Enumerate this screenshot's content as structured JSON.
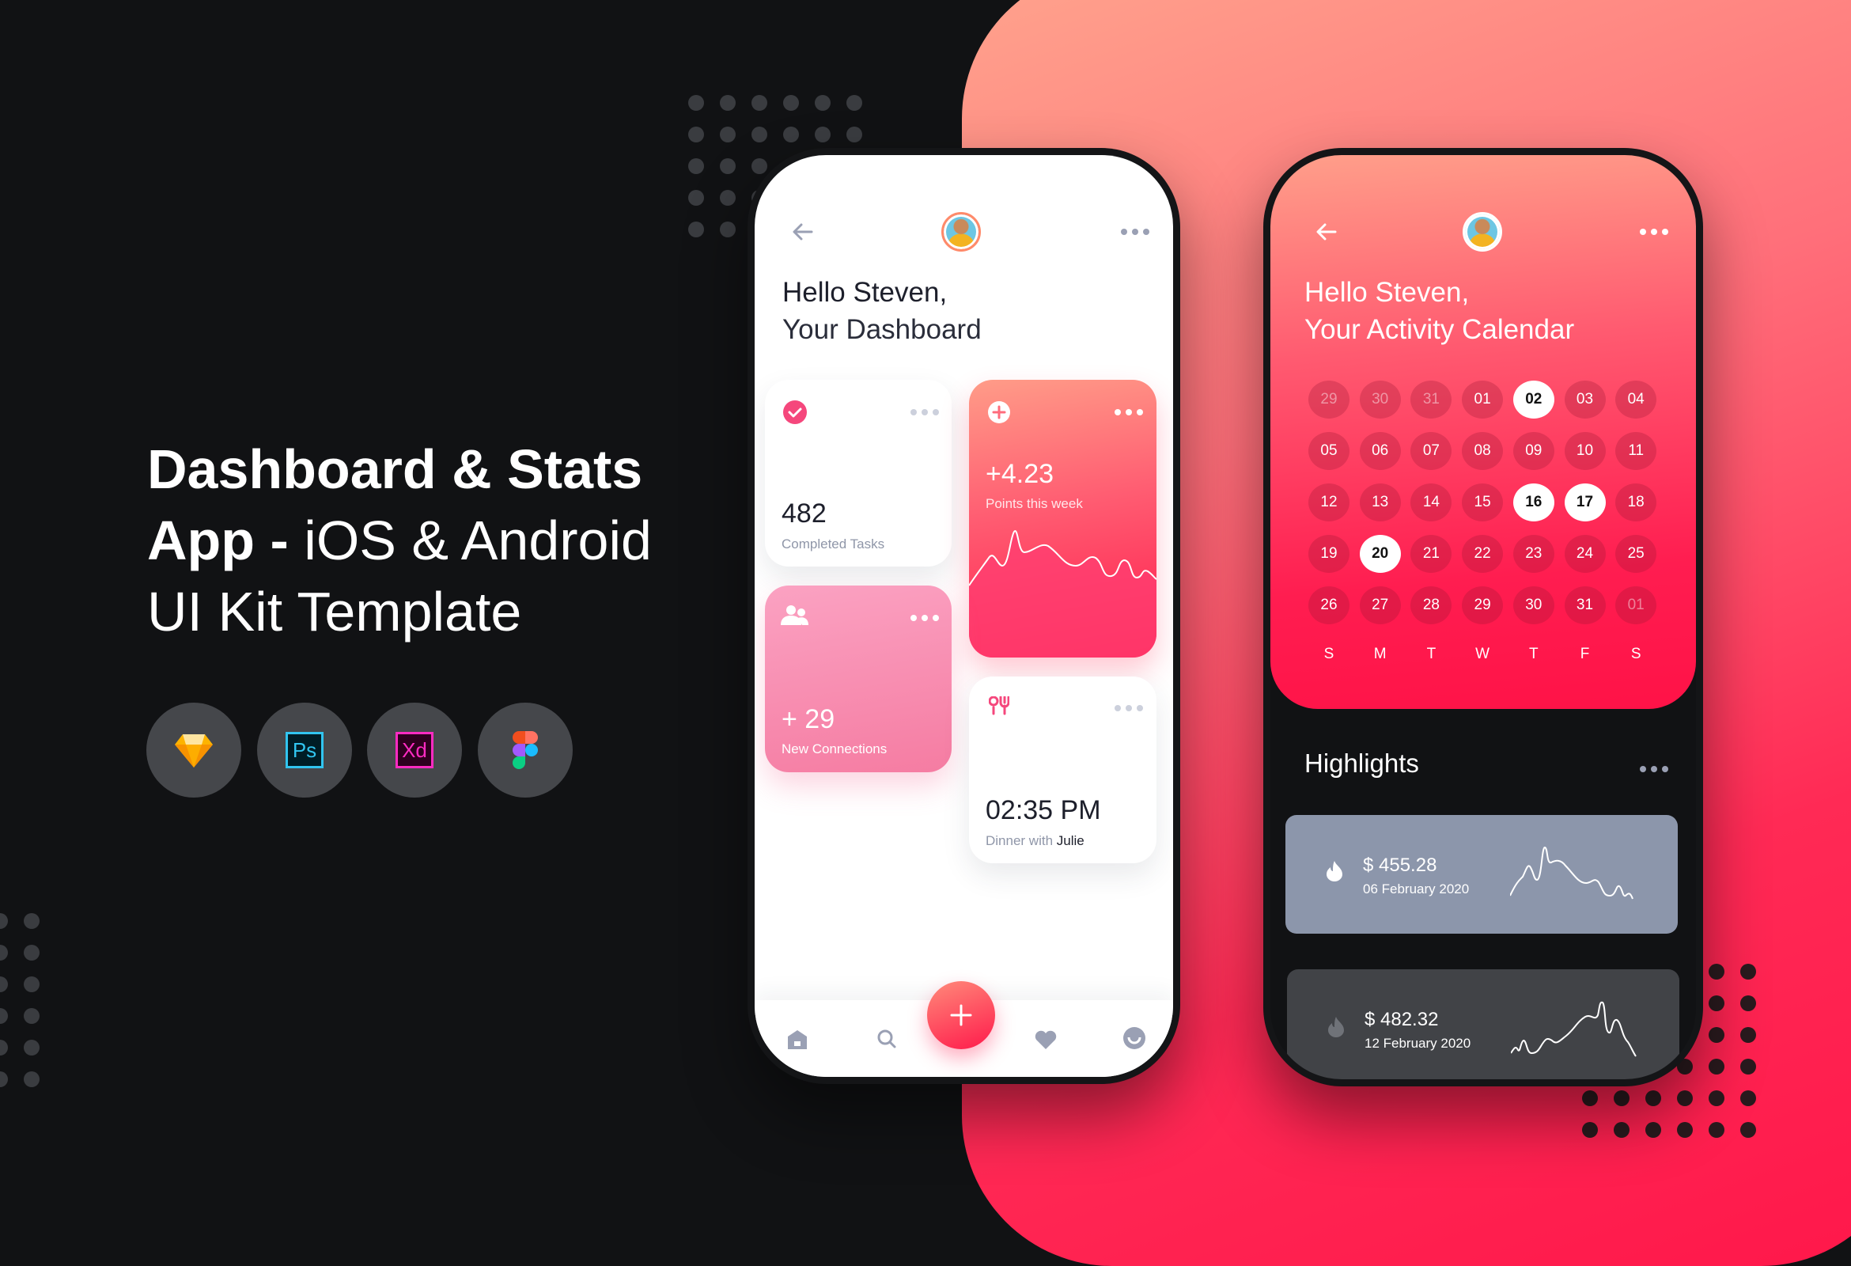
{
  "hero": {
    "line1": "Dashboard & Stats",
    "line2_bold": "App - ",
    "line2_light": " iOS & Android",
    "line3": "UI Kit Template"
  },
  "tools": [
    {
      "name": "Sketch",
      "icon": "sketch-diamond-icon"
    },
    {
      "name": "Ps",
      "icon": "photoshop-icon",
      "color": "#31c5f0"
    },
    {
      "name": "Xd",
      "icon": "adobe-xd-icon",
      "color": "#ff2bc2"
    },
    {
      "name": "Figma",
      "icon": "figma-icon"
    }
  ],
  "dashboard": {
    "greeting": "Hello Steven,",
    "title": "Your Dashboard",
    "cards": {
      "tasks": {
        "value": "482",
        "label": "Completed Tasks"
      },
      "points": {
        "value": "+4.23",
        "label": "Points this week"
      },
      "connections": {
        "value": "+ 29",
        "label": "New Connections"
      },
      "event": {
        "value": "02:35 PM",
        "label": "Dinner with",
        "person": "Julie"
      }
    },
    "nav": [
      "home-icon",
      "search-icon",
      "add-icon",
      "heart-icon",
      "profile-icon"
    ]
  },
  "calendar": {
    "greeting": "Hello Steven,",
    "title": "Your Activity Calendar",
    "weekdays": [
      "S",
      "M",
      "T",
      "W",
      "T",
      "F",
      "S"
    ],
    "weeks": [
      [
        {
          "d": "29",
          "s": "muted"
        },
        {
          "d": "30",
          "s": "muted"
        },
        {
          "d": "31",
          "s": "muted"
        },
        {
          "d": "01"
        },
        {
          "d": "02",
          "s": "sel"
        },
        {
          "d": "03"
        },
        {
          "d": "04"
        }
      ],
      [
        {
          "d": "05"
        },
        {
          "d": "06"
        },
        {
          "d": "07"
        },
        {
          "d": "08"
        },
        {
          "d": "09"
        },
        {
          "d": "10"
        },
        {
          "d": "11"
        }
      ],
      [
        {
          "d": "12"
        },
        {
          "d": "13"
        },
        {
          "d": "14"
        },
        {
          "d": "15"
        },
        {
          "d": "16",
          "s": "sel"
        },
        {
          "d": "17",
          "s": "sel"
        },
        {
          "d": "18"
        }
      ],
      [
        {
          "d": "19"
        },
        {
          "d": "20",
          "s": "sel"
        },
        {
          "d": "21"
        },
        {
          "d": "22"
        },
        {
          "d": "23"
        },
        {
          "d": "24"
        },
        {
          "d": "25"
        }
      ],
      [
        {
          "d": "26"
        },
        {
          "d": "27"
        },
        {
          "d": "28"
        },
        {
          "d": "29"
        },
        {
          "d": "30"
        },
        {
          "d": "31"
        },
        {
          "d": "01",
          "s": "muted"
        }
      ]
    ]
  },
  "highlights": {
    "title": "Highlights",
    "items": [
      {
        "amount": "$ 455.28",
        "date": "06 February 2020",
        "bg": "#8c96ab"
      },
      {
        "amount": "$ 482.32",
        "date": "12 February 2020",
        "bg": "#414347"
      }
    ]
  },
  "colors": {
    "accent": "#ff1f4f",
    "pink": "#f98db0",
    "dark": "#111214"
  }
}
